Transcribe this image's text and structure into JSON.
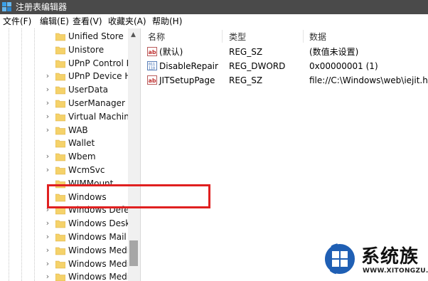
{
  "window": {
    "title": "注册表编辑器"
  },
  "menu": [
    "文件(F)",
    "编辑(E)",
    "查看(V)",
    "收藏夹(A)",
    "帮助(H)"
  ],
  "tree": {
    "items": [
      {
        "label": "Unified Store",
        "expandable": false
      },
      {
        "label": "Unistore",
        "expandable": false
      },
      {
        "label": "UPnP Control P",
        "expandable": false
      },
      {
        "label": "UPnP Device Ho",
        "expandable": true
      },
      {
        "label": "UserData",
        "expandable": true
      },
      {
        "label": "UserManager",
        "expandable": true
      },
      {
        "label": "Virtual Machine",
        "expandable": true
      },
      {
        "label": "WAB",
        "expandable": true
      },
      {
        "label": "Wallet",
        "expandable": false
      },
      {
        "label": "Wbem",
        "expandable": true
      },
      {
        "label": "WcmSvc",
        "expandable": true
      },
      {
        "label": "WIMMount",
        "expandable": false
      },
      {
        "label": "Windows",
        "expandable": false
      },
      {
        "label": "Windows Defen",
        "expandable": true
      },
      {
        "label": "Windows Deskt",
        "expandable": true
      },
      {
        "label": "Windows Mail",
        "expandable": true
      },
      {
        "label": "Windows Media",
        "expandable": true
      },
      {
        "label": "Windows Media",
        "expandable": true
      },
      {
        "label": "Windows Media",
        "expandable": true
      }
    ]
  },
  "list": {
    "columns": [
      "名称",
      "类型",
      "数据"
    ],
    "rows": [
      {
        "name": "(默认)",
        "type": "REG_SZ",
        "data": "(数值未设置)",
        "icon": "string-value-icon"
      },
      {
        "name": "DisableRepair",
        "type": "REG_DWORD",
        "data": "0x00000001 (1)",
        "icon": "dword-value-icon"
      },
      {
        "name": "JITSetupPage",
        "type": "REG_SZ",
        "data": "file://C:\\Windows\\web\\iejit.htm",
        "icon": "string-value-icon"
      }
    ]
  },
  "watermark": {
    "brand": "系统族",
    "url": "WWW.XITONGZU.COM"
  },
  "colors": {
    "titlebar": "#4a4a4a",
    "highlight": "#e02020",
    "folder": "#f5d26a"
  }
}
